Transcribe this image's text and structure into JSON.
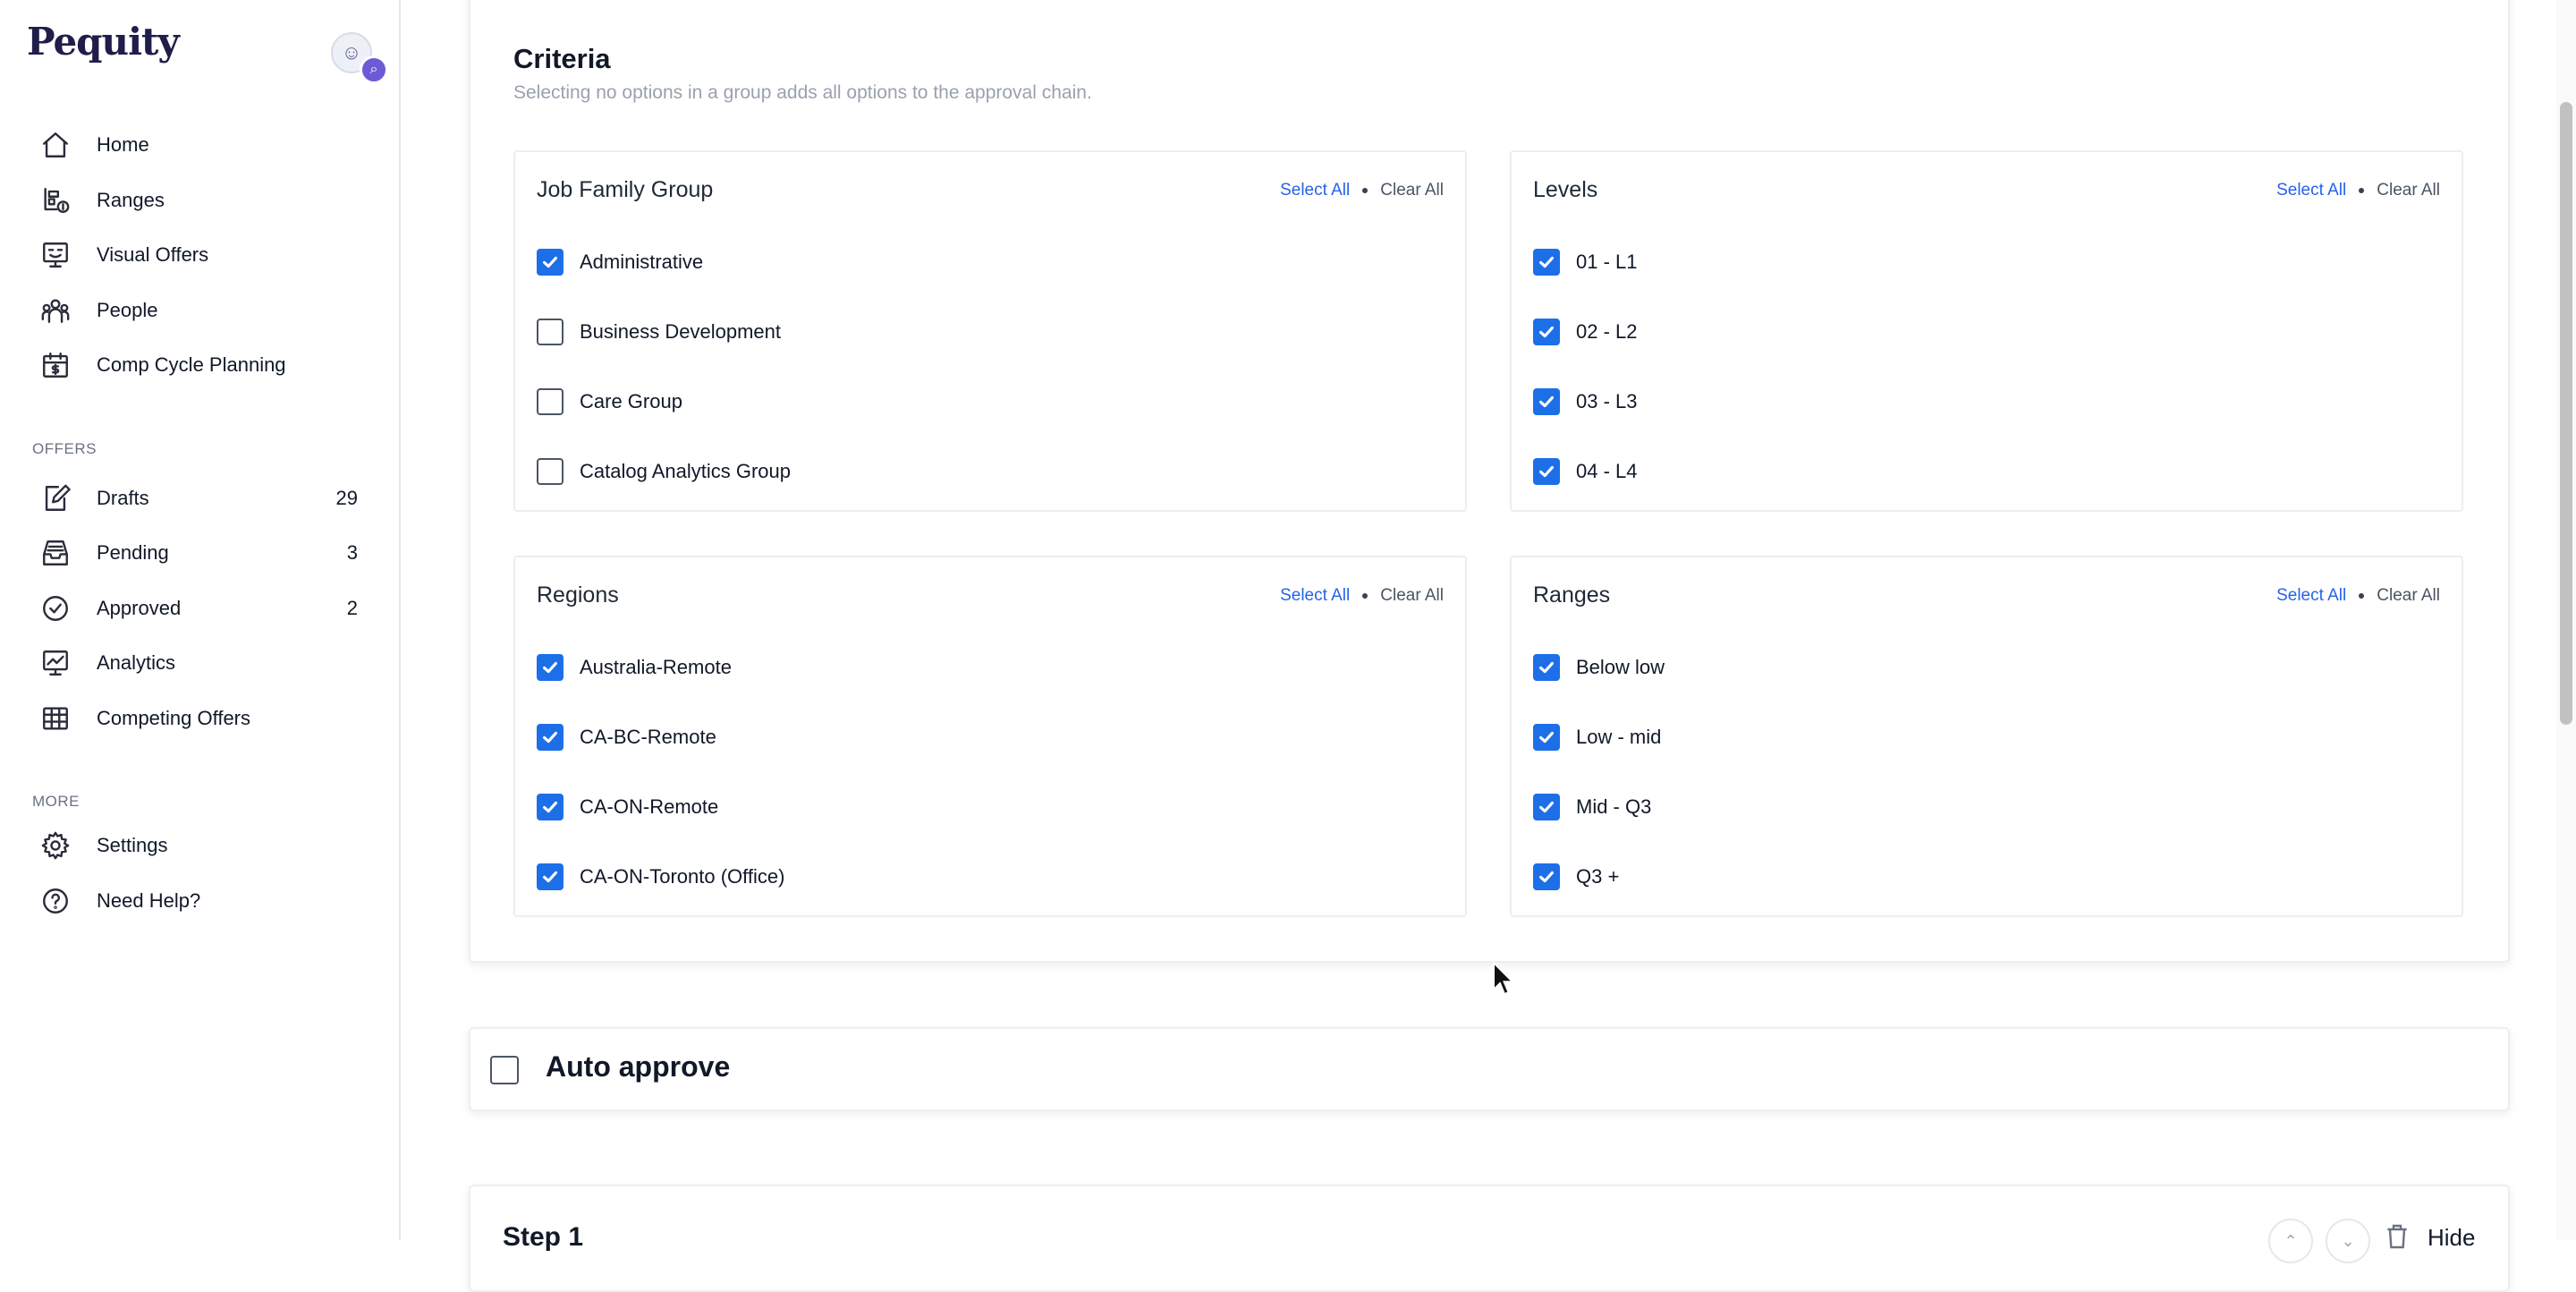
{
  "brand": {
    "logo_text": "Pequity"
  },
  "sidebar": {
    "main_items": [
      {
        "label": "Home",
        "icon": "home-icon"
      },
      {
        "label": "Ranges",
        "icon": "ranges-icon"
      },
      {
        "label": "Visual Offers",
        "icon": "visual-offers-icon"
      },
      {
        "label": "People",
        "icon": "people-icon"
      },
      {
        "label": "Comp Cycle Planning",
        "icon": "calendar-dollar-icon"
      }
    ],
    "offers_section_label": "OFFERS",
    "offers_items": [
      {
        "label": "Drafts",
        "count": "29",
        "icon": "draft-edit-icon"
      },
      {
        "label": "Pending",
        "count": "3",
        "icon": "inbox-icon"
      },
      {
        "label": "Approved",
        "count": "2",
        "icon": "check-circle-icon"
      },
      {
        "label": "Analytics",
        "icon": "analytics-icon"
      },
      {
        "label": "Competing Offers",
        "icon": "table-icon"
      }
    ],
    "more_section_label": "MORE",
    "more_items": [
      {
        "label": "Settings",
        "icon": "gear-icon"
      },
      {
        "label": "Need Help?",
        "icon": "help-circle-icon"
      }
    ]
  },
  "criteria": {
    "title": "Criteria",
    "subtitle": "Selecting no options in a group adds all options to the approval chain.",
    "select_all_label": "Select All",
    "clear_all_label": "Clear All",
    "groups": [
      {
        "title": "Job Family Group",
        "options": [
          {
            "label": "Administrative",
            "checked": true
          },
          {
            "label": "Business Development",
            "checked": false
          },
          {
            "label": "Care Group",
            "checked": false
          },
          {
            "label": "Catalog Analytics Group",
            "checked": false
          }
        ]
      },
      {
        "title": "Levels",
        "options": [
          {
            "label": "01 - L1",
            "checked": true
          },
          {
            "label": "02 - L2",
            "checked": true
          },
          {
            "label": "03 - L3",
            "checked": true
          },
          {
            "label": "04 - L4",
            "checked": true
          }
        ]
      },
      {
        "title": "Regions",
        "options": [
          {
            "label": "Australia-Remote",
            "checked": true
          },
          {
            "label": "CA-BC-Remote",
            "checked": true
          },
          {
            "label": "CA-ON-Remote",
            "checked": true
          },
          {
            "label": "CA-ON-Toronto (Office)",
            "checked": true
          }
        ]
      },
      {
        "title": "Ranges",
        "options": [
          {
            "label": "Below low",
            "checked": true
          },
          {
            "label": "Low - mid",
            "checked": true
          },
          {
            "label": "Mid - Q3",
            "checked": true
          },
          {
            "label": "Q3 +",
            "checked": true
          }
        ]
      }
    ]
  },
  "auto_approve": {
    "label": "Auto approve",
    "checked": false
  },
  "step": {
    "title": "Step 1",
    "hide_label": "Hide"
  },
  "colors": {
    "accent": "#1d6fe8",
    "link": "#2563eb",
    "muted": "#9aa1ad"
  }
}
